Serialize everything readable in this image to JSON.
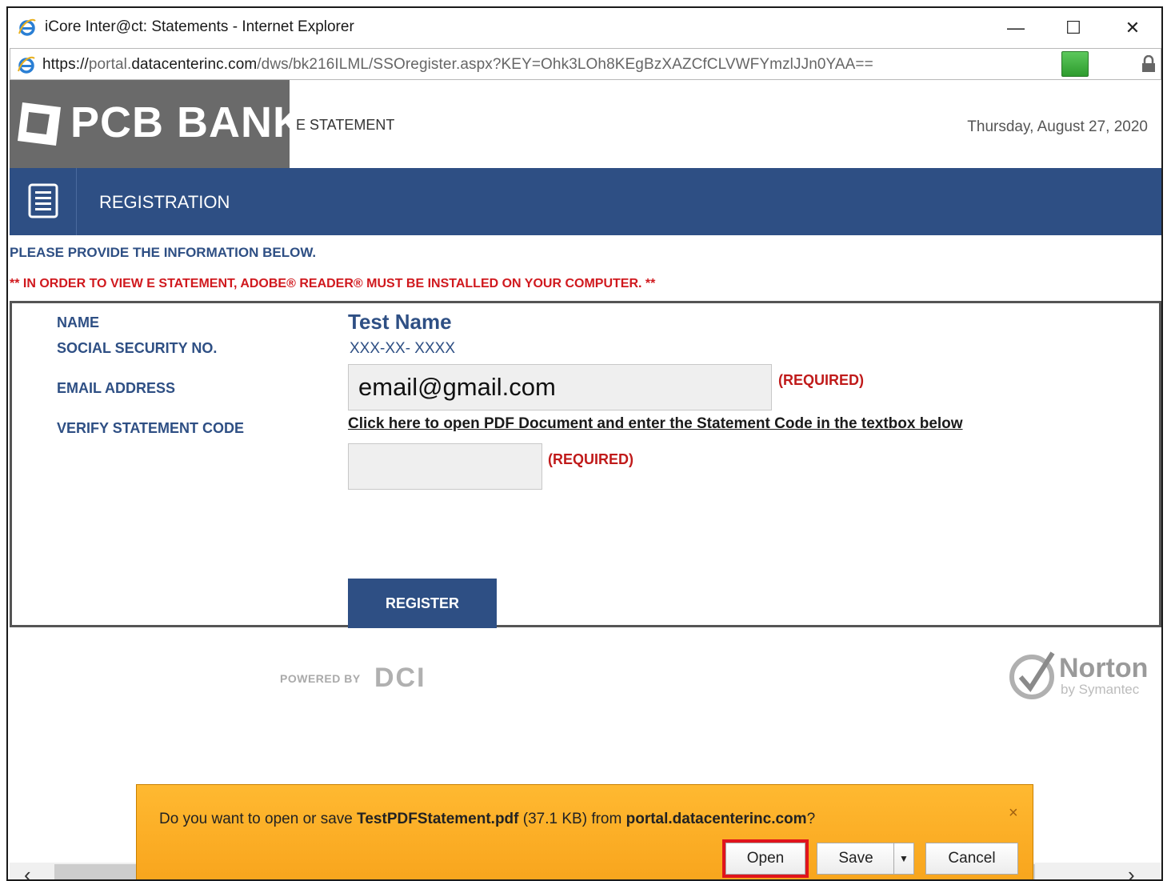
{
  "window": {
    "title": "iCore Inter@ct: Statements - Internet Explorer",
    "controls": {
      "minimize": "—",
      "maximize": "☐",
      "close": "✕"
    }
  },
  "address": {
    "scheme": "https://",
    "pre_host": "portal.",
    "host": "datacenterinc.com",
    "path": "/dws/bk216ILML/SSOregister.aspx?KEY=Ohk3LOh8KEgBzXAZCfCLVWFYmzlJJn0YAA=="
  },
  "header": {
    "brand": "PCB BANK",
    "section": "E STATEMENT",
    "date": "Thursday, August 27, 2020"
  },
  "registration_bar": {
    "title": "REGISTRATION"
  },
  "notices": {
    "provide_info": "PLEASE PROVIDE THE INFORMATION BELOW.",
    "adobe": "** IN ORDER TO VIEW E STATEMENT, ADOBE® READER® MUST BE INSTALLED ON YOUR COMPUTER. **"
  },
  "form": {
    "labels": {
      "name": "NAME",
      "ssn": "SOCIAL SECURITY NO.",
      "email": "EMAIL ADDRESS",
      "verify": "VERIFY STATEMENT CODE"
    },
    "name_value": "Test Name",
    "ssn_value": "XXX-XX- XXXX",
    "email_value": "email@gmail.com",
    "required": "(REQUIRED)",
    "pdf_link": "Click here to open PDF Document and enter the Statement Code in the textbox below",
    "code_value": "",
    "register_label": "REGISTER"
  },
  "footer": {
    "powered_by": "POWERED BY",
    "dci": "DCI",
    "norton": "Norton",
    "norton_sub": "by Symantec"
  },
  "download_bar": {
    "prefix": "Do you want to open or save ",
    "filename": "TestPDFStatement.pdf",
    "size": " (37.1 KB) from ",
    "source": "portal.datacenterinc.com",
    "suffix": "?",
    "close": "×",
    "open_label": "Open",
    "save_label": "Save",
    "save_arrow": "▼",
    "cancel_label": "Cancel"
  },
  "scroll": {
    "left": "‹",
    "right": "›"
  },
  "colors": {
    "brand_blue": "#2e4f84",
    "required_red": "#c01a1a",
    "download_orange": "#f7a21a"
  }
}
